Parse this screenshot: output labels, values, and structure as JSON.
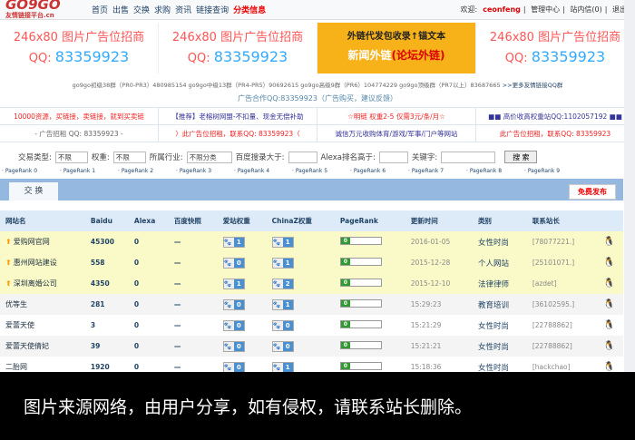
{
  "header": {
    "logo": "GO9GO",
    "logo_sub": "友情链接平台.cn",
    "nav": [
      "首页",
      "出售",
      "交换",
      "求购",
      "资讯",
      "链接查询",
      "分类信息"
    ],
    "welcome": "欢迎:",
    "username": "ceonfeng",
    "user_links": [
      "管理中心",
      "站内信(0)",
      "退出"
    ]
  },
  "ads": [
    {
      "title": "246x80 图片广告位招商",
      "qq_label": "QQ:",
      "qq": "83359923"
    },
    {
      "title": "246x80 图片广告位招商",
      "qq_label": "QQ:",
      "qq": "83359923"
    },
    {
      "line1": "外链代发包收录↑锚文本",
      "line2a": "新闻外链",
      "line2b": "(论坛外链)"
    },
    {
      "title": "246x80 图片广告位招商",
      "qq_label": "QQ:",
      "qq": "83359923"
    }
  ],
  "groups": {
    "text": "go9go初级38群（PR0-PR3）480985154 go9go中级13群（PR4-PR5）90692615 go9go高级9群（PR6）104774229 go9go顶级群（PR7以上）83687665",
    "more": ">>更多友情链接QQ群"
  },
  "coop": "广告合作QQ:83359923（广告购买，建议反馈）",
  "text_ads": [
    "10000资源，买链接，卖链接，就到买卖链",
    "【推荐】老榕树网盟-不扣量、现金无偿补助",
    "☆明链 权重2-5 仅需3元/条/月☆",
    "■■ 高价收高权重站QQ:1102057192 ■■",
    "- 广告招租 QQ: 83359923 -",
    "〉此广告位招租，联系QQ: 83359923〈",
    "诚信万元收购体育/游戏/军事/门户等网站",
    "此广告位招租，联系QQ: 83359923"
  ],
  "filters": {
    "trade_label": "交易类型:",
    "trade": "不限",
    "weight_label": "权重:",
    "weight": "不限",
    "industry_label": "所属行业:",
    "industry": "不限分类",
    "baidu_label": "百度搜录大于:",
    "alexa_label": "Alexa排名高于:",
    "keyword_label": "关键字:",
    "search": "搜 索"
  },
  "pagerank": [
    "· PageRank 0",
    "· PageRank 1",
    "· PageRank 2",
    "· PageRank 3",
    "· PageRank 4",
    "· PageRank 5",
    "· PageRank 6",
    "· PageRank 7",
    "· PageRank 8",
    "· PageRank 9"
  ],
  "tab": "交 换",
  "publish": "免费发布",
  "table": {
    "headers": [
      "网站名",
      "Baidu",
      "Alexa",
      "百度快照",
      "爱站权重",
      "ChinaZ权重",
      "PageRank",
      "更新时间",
      "类别",
      "联系站长",
      ""
    ],
    "rows": [
      {
        "name": "爱购网官网",
        "baidu": "45300",
        "alexa": "0",
        "snap": "—",
        "aizhan": "1",
        "chinaz": "1",
        "pr": "0",
        "time": "2016-01-05",
        "cat": "女性时尚",
        "contact": "[78077221.]",
        "top": true
      },
      {
        "name": "惠州网站建设",
        "baidu": "558",
        "alexa": "0",
        "snap": "—",
        "aizhan": "0",
        "chinaz": "1",
        "pr": "0",
        "time": "2015-12-28",
        "cat": "个人网站",
        "contact": "[25101071.]",
        "top": true
      },
      {
        "name": "深圳离婚公司",
        "baidu": "4350",
        "alexa": "0",
        "snap": "—",
        "aizhan": "1",
        "chinaz": "2",
        "pr": "0",
        "time": "2015-12-10",
        "cat": "法律律师",
        "contact": "[azdet]",
        "top": true
      },
      {
        "name": "优等生",
        "baidu": "281",
        "alexa": "0",
        "snap": "—",
        "aizhan": "0",
        "chinaz": "1",
        "pr": "0",
        "time": "15:29:23",
        "cat": "教育培训",
        "contact": "[36102595.]",
        "top": false
      },
      {
        "name": "爱蕾天使",
        "baidu": "3",
        "alexa": "0",
        "snap": "—",
        "aizhan": "0",
        "chinaz": "0",
        "pr": "0",
        "time": "15:21:29",
        "cat": "女性时尚",
        "contact": "[22788862]",
        "top": false
      },
      {
        "name": "爱蕾天使倩妃",
        "baidu": "39",
        "alexa": "0",
        "snap": "—",
        "aizhan": "0",
        "chinaz": "0",
        "pr": "0",
        "time": "15:21:21",
        "cat": "女性时尚",
        "contact": "[22788862]",
        "top": false
      },
      {
        "name": "二胎网",
        "baidu": "1920",
        "alexa": "0",
        "snap": "—",
        "aizhan": "0",
        "chinaz": "1",
        "pr": "0",
        "time": "15:18:36",
        "cat": "女性时尚",
        "contact": "[hackchao]",
        "top": false
      }
    ]
  },
  "caption": "图片来源网络，由用户分享，如有侵权，请联系站长删除。"
}
